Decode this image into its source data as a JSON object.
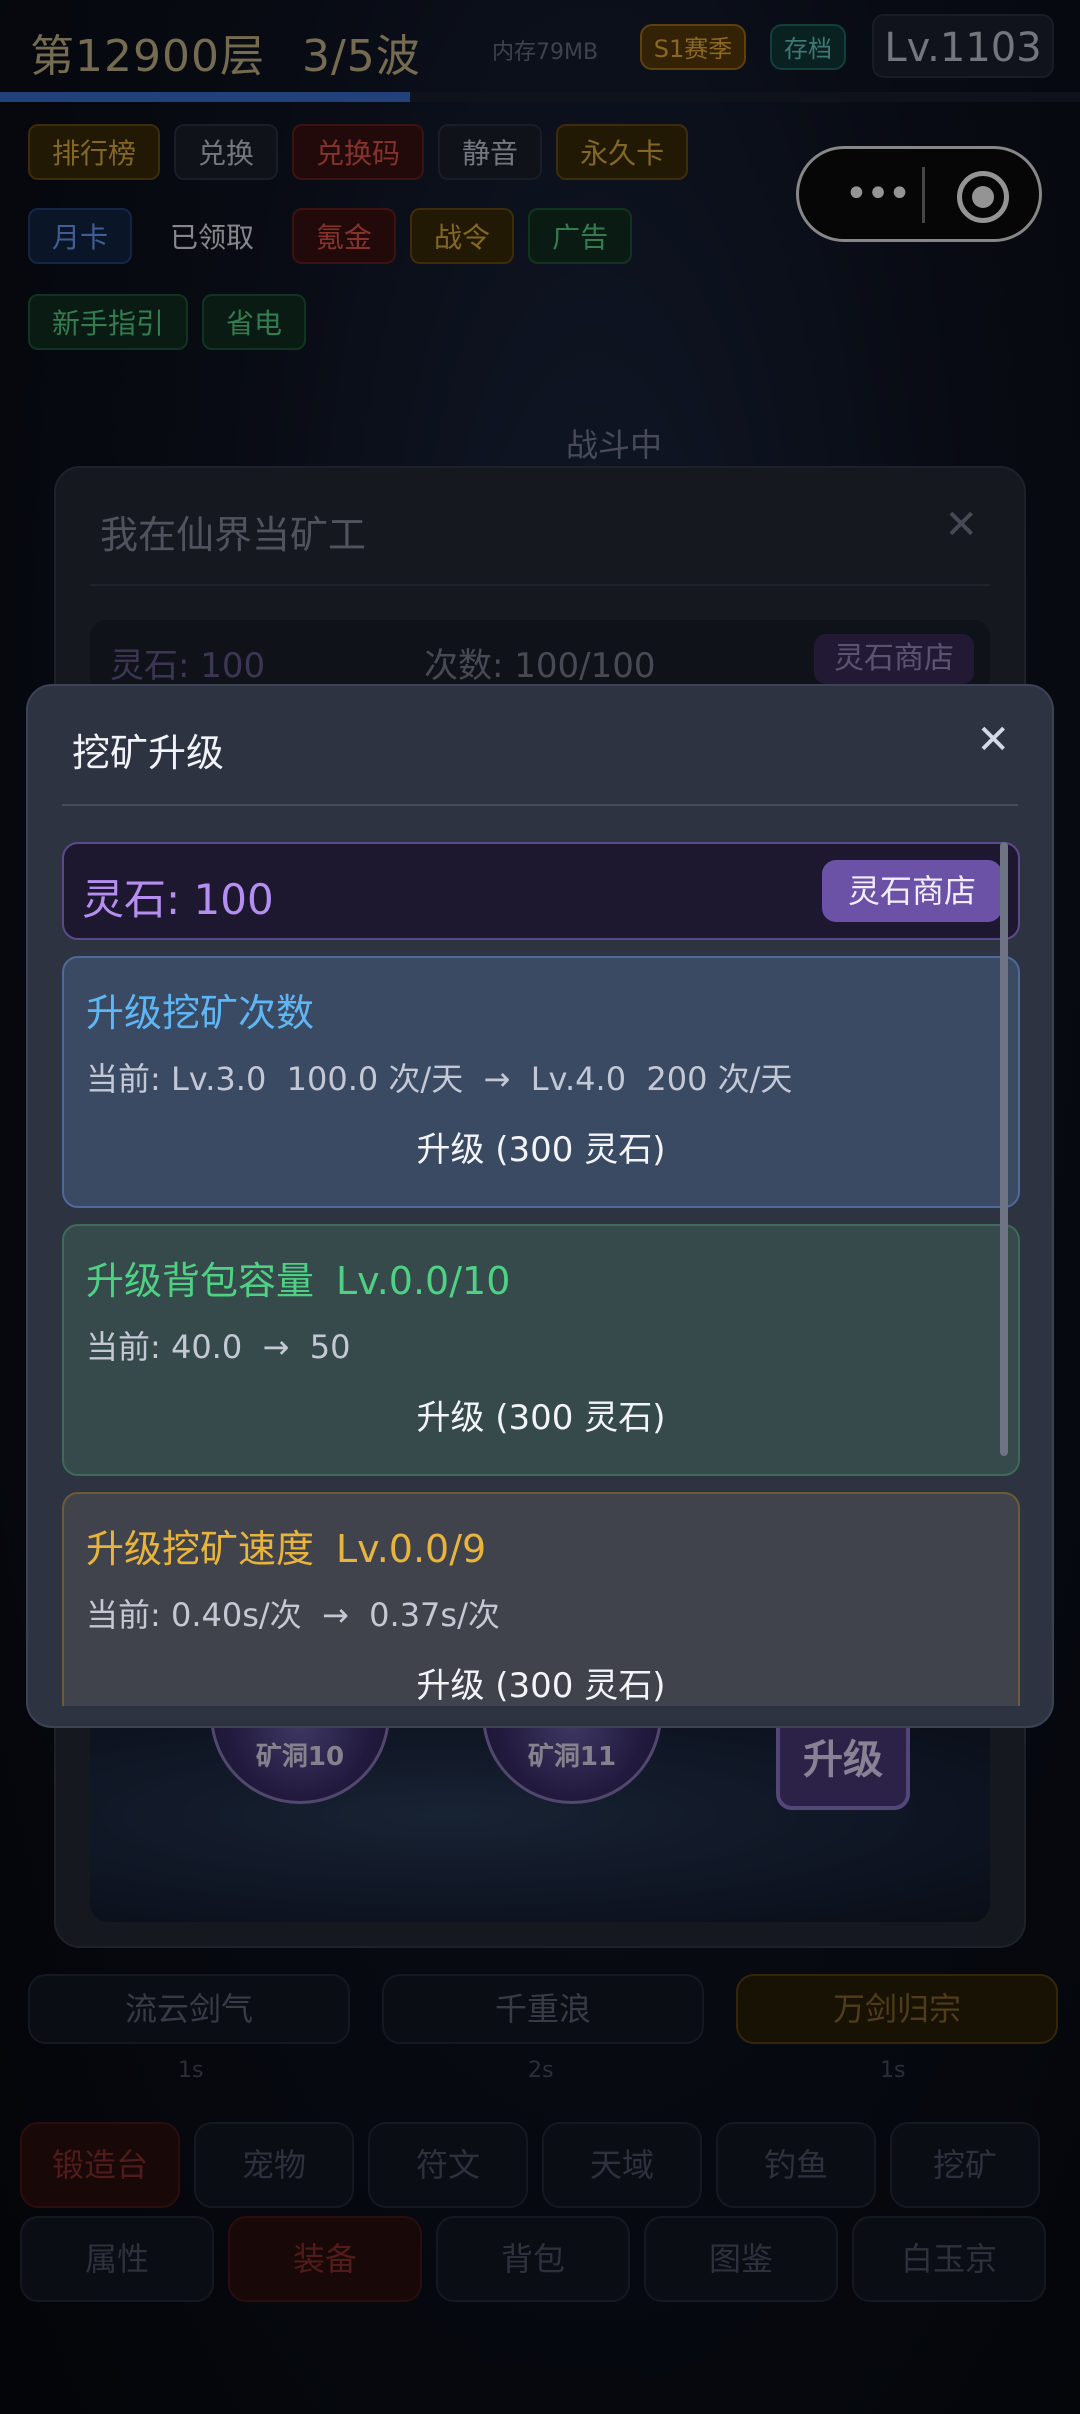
{
  "topbar": {
    "floor": "第12900层",
    "wave": "3/5波",
    "memory": "内存79MB",
    "season": "S1赛季",
    "save": "存档",
    "level": "Lv.1103"
  },
  "progress": {
    "fraction": 0.38
  },
  "menu": {
    "row1": [
      "排行榜",
      "兑换",
      "兑换码",
      "静音",
      "永久卡"
    ],
    "row2": [
      "月卡",
      "已领取",
      "氪金",
      "战令",
      "广告"
    ],
    "row3": [
      "新手指引",
      "省电"
    ]
  },
  "bg_dialog": {
    "title": "我在仙界当矿工",
    "close": "✕",
    "stone": "灵石: 100",
    "count": "次数: 100/100",
    "shop": "灵石商店",
    "cave_left": "矿洞10",
    "cave_right": "矿洞11",
    "upgrade_badge": "升级"
  },
  "battle": {
    "status": "战斗中"
  },
  "skills": {
    "items": [
      "流云剑气",
      "千重浪",
      "万剑归宗"
    ],
    "cooldowns": [
      "1s",
      "2s",
      "1s"
    ]
  },
  "tabs": {
    "row1": [
      "锻造台",
      "宠物",
      "符文",
      "天域",
      "钓鱼",
      "挖矿"
    ],
    "row2": [
      "属性",
      "装备",
      "背包",
      "图鉴",
      "白玉京"
    ]
  },
  "dialog": {
    "title": "挖矿升级",
    "close": "✕",
    "stone": "灵石: 100",
    "shop": "灵石商店",
    "cards": [
      {
        "title": "升级挖矿次数",
        "level": "",
        "desc": "当前: Lv.3.0  100.0 次/天  →  Lv.4.0  200 次/天",
        "button": "升级 (300 灵石)"
      },
      {
        "title": "升级背包容量",
        "level": "Lv.0.0/10",
        "desc": "当前: 40.0  →  50",
        "button": "升级 (300 灵石)"
      },
      {
        "title": "升级挖矿速度",
        "level": "Lv.0.0/9",
        "desc": "当前: 0.40s/次  →  0.37s/次",
        "button": "升级 (300 灵石)"
      }
    ]
  },
  "capsule": {
    "more": "•••"
  },
  "colors": {
    "accent_purple": "#6b52a6",
    "blue_title": "#5fb6f5",
    "green_title": "#4fd184",
    "gold_title": "#e8b43c"
  }
}
